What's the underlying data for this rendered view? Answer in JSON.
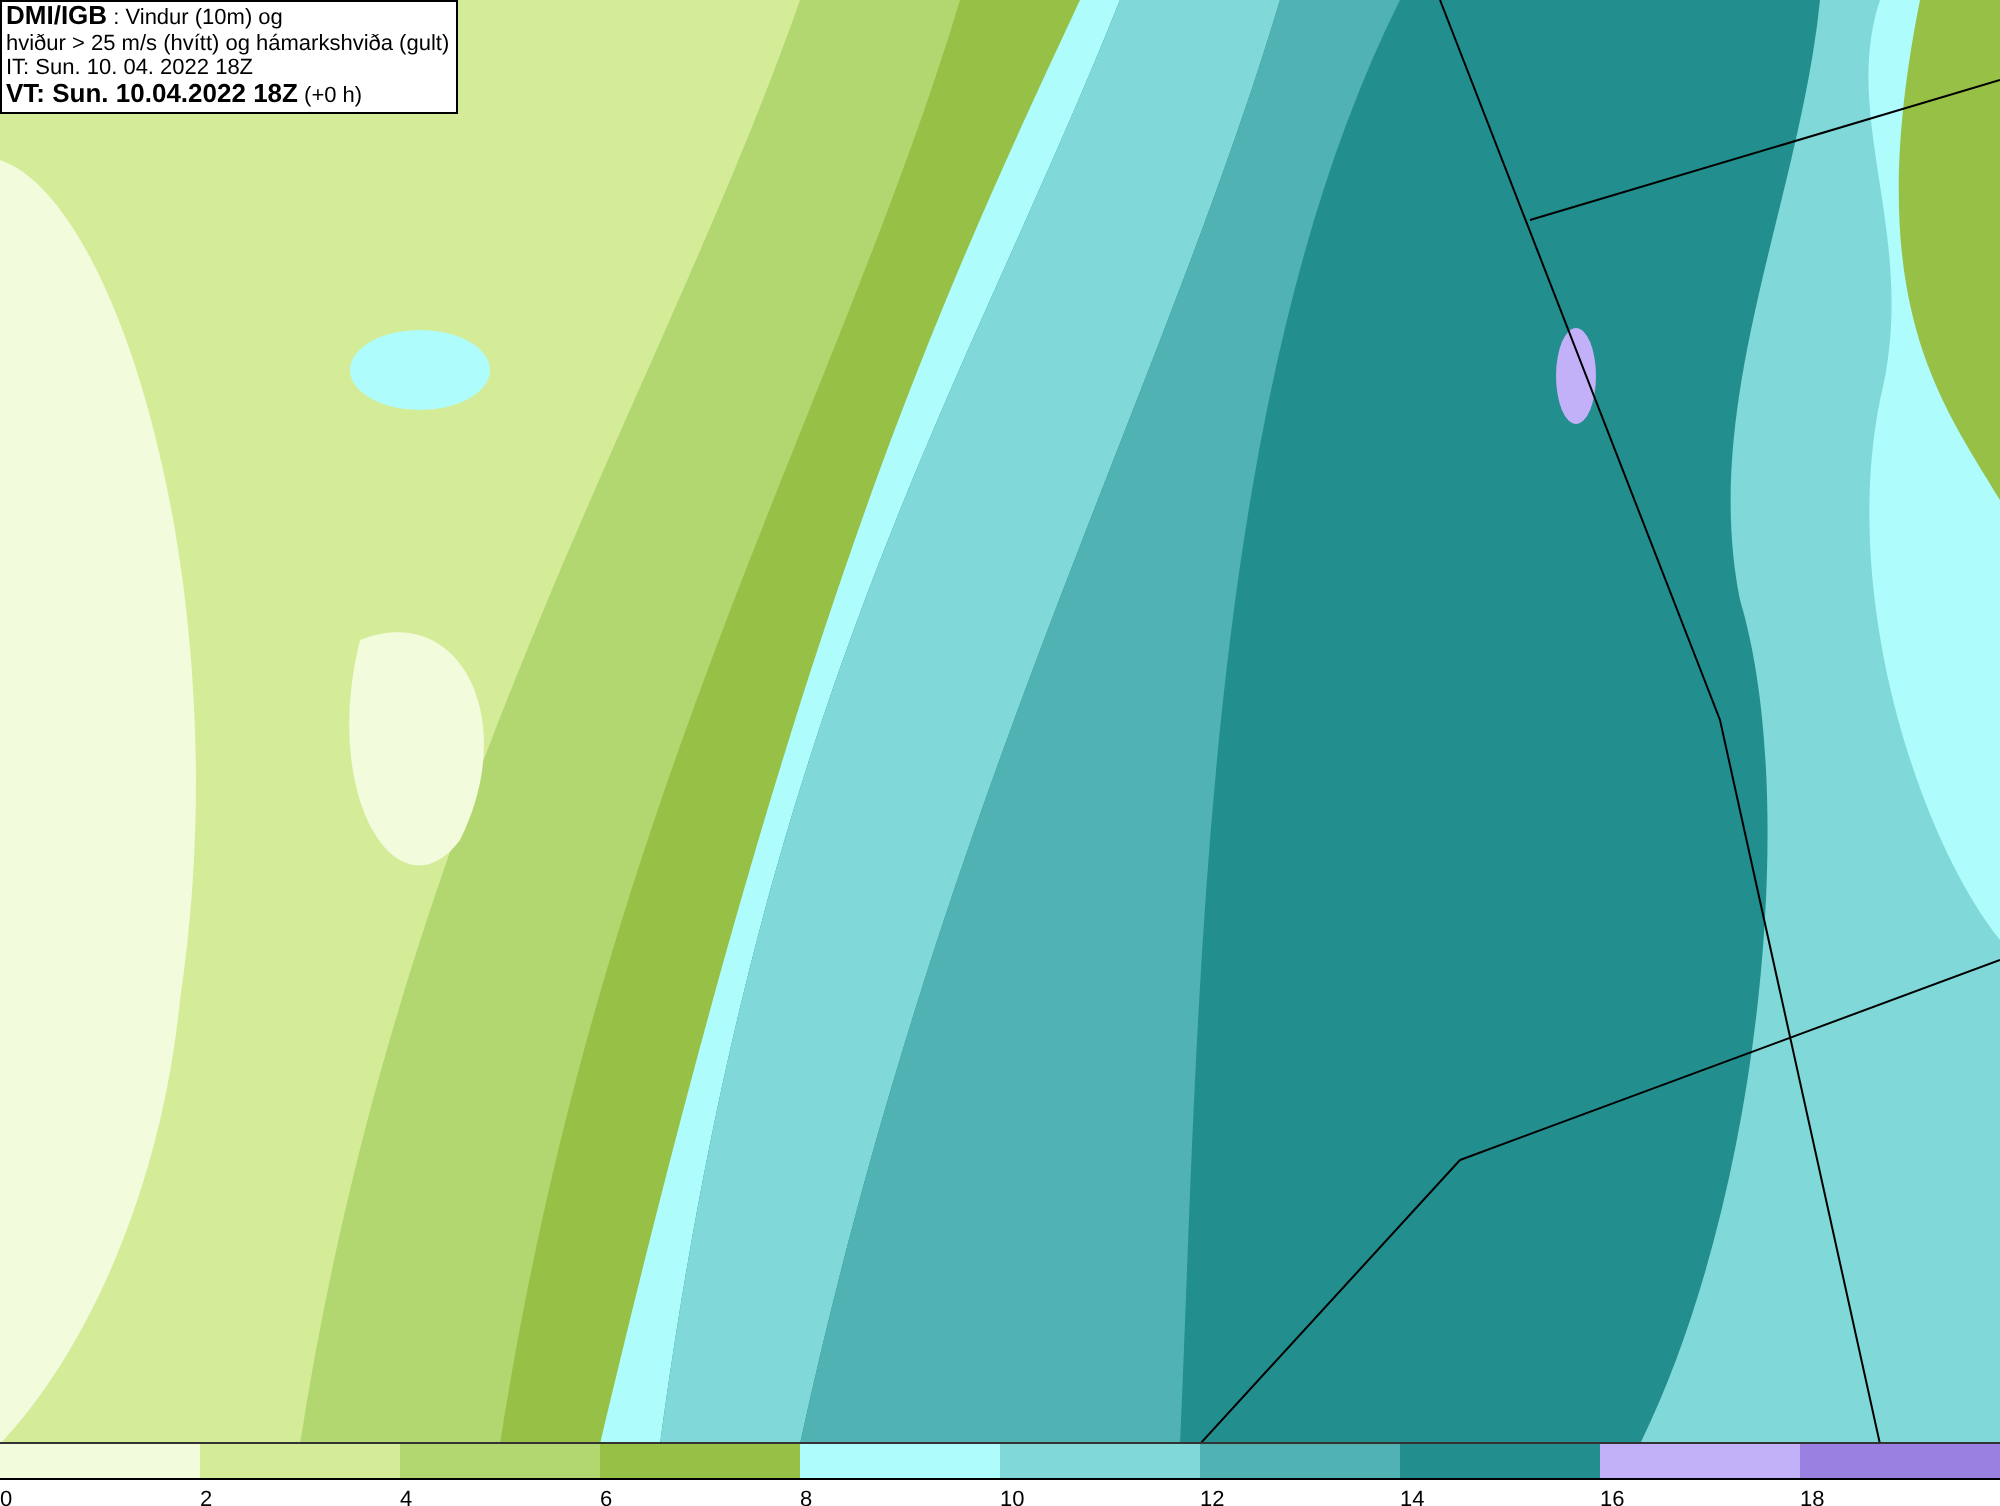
{
  "header": {
    "lines": [
      "**DMI/IGB** : Vindur (10m) og",
      "hviður > 25 m/s (hvítt) og hámarkshviða (gult)",
      "IT: Sun. 10. 04. 2022 18Z",
      "**VT: Sun. 10.04.2022 18Z** (+0 h)"
    ]
  },
  "legend": [
    {
      "label": "0",
      "color": "#f2fbdc"
    },
    {
      "label": "2",
      "color": "#d4ec98"
    },
    {
      "label": "4",
      "color": "#b2d770"
    },
    {
      "label": "6",
      "color": "#96c046"
    },
    {
      "label": "8",
      "color": "#aefcfc"
    },
    {
      "label": "10",
      "color": "#80d8d8"
    },
    {
      "label": "12",
      "color": "#50b2b2"
    },
    {
      "label": "14",
      "color": "#238e8e"
    },
    {
      "label": "16",
      "color": "#c2b0f8"
    },
    {
      "label": "18",
      "color": "#9a80e0"
    }
  ]
}
